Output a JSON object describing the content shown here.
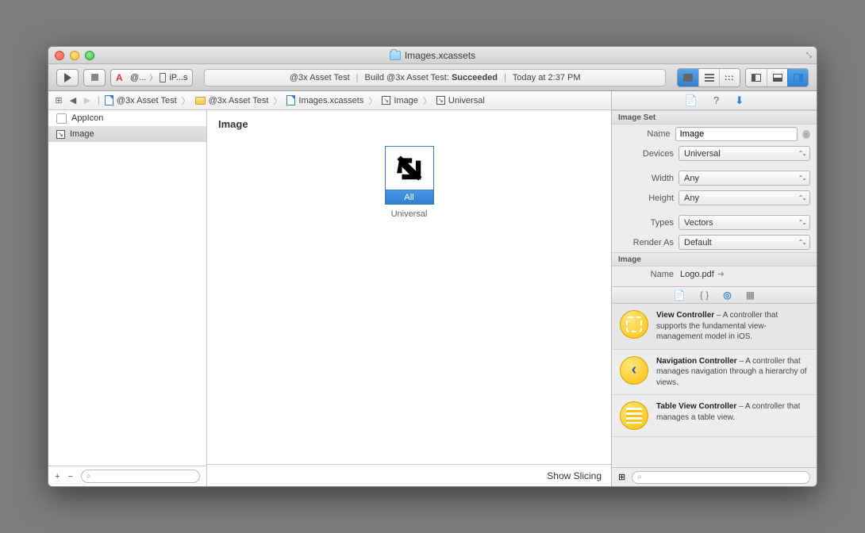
{
  "window": {
    "title": "Images.xcassets"
  },
  "toolbar": {
    "scheme_name": "@...",
    "scheme_dest": "iP...s",
    "status_app": "@3x Asset Test",
    "status_build": "Build @3x Asset Test:",
    "status_result": "Succeeded",
    "status_time": "Today at 2:37 PM"
  },
  "jumpbar": {
    "items": [
      "@3x Asset Test",
      "@3x Asset Test",
      "Images.xcassets",
      "Image",
      "Universal"
    ]
  },
  "asset_list": {
    "items": [
      {
        "name": "AppIcon",
        "selected": false
      },
      {
        "name": "Image",
        "selected": true
      }
    ],
    "add": "+",
    "remove": "−"
  },
  "canvas": {
    "title": "Image",
    "slot_label": "All",
    "slot_caption": "Universal",
    "show_slicing": "Show Slicing"
  },
  "inspector": {
    "image_set_header": "Image Set",
    "name_label": "Name",
    "name_value": "Image",
    "devices_label": "Devices",
    "devices_value": "Universal",
    "width_label": "Width",
    "width_value": "Any",
    "height_label": "Height",
    "height_value": "Any",
    "types_label": "Types",
    "types_value": "Vectors",
    "render_label": "Render As",
    "render_value": "Default",
    "image_header": "Image",
    "image_name_label": "Name",
    "image_name_value": "Logo.pdf"
  },
  "library": {
    "items": [
      {
        "title": "View Controller",
        "desc": " – A controller that supports the fundamental view-management model in iOS."
      },
      {
        "title": "Navigation Controller",
        "desc": " – A controller that manages navigation through a hierarchy of views."
      },
      {
        "title": "Table View Controller",
        "desc": " – A controller that manages a table view."
      }
    ]
  }
}
